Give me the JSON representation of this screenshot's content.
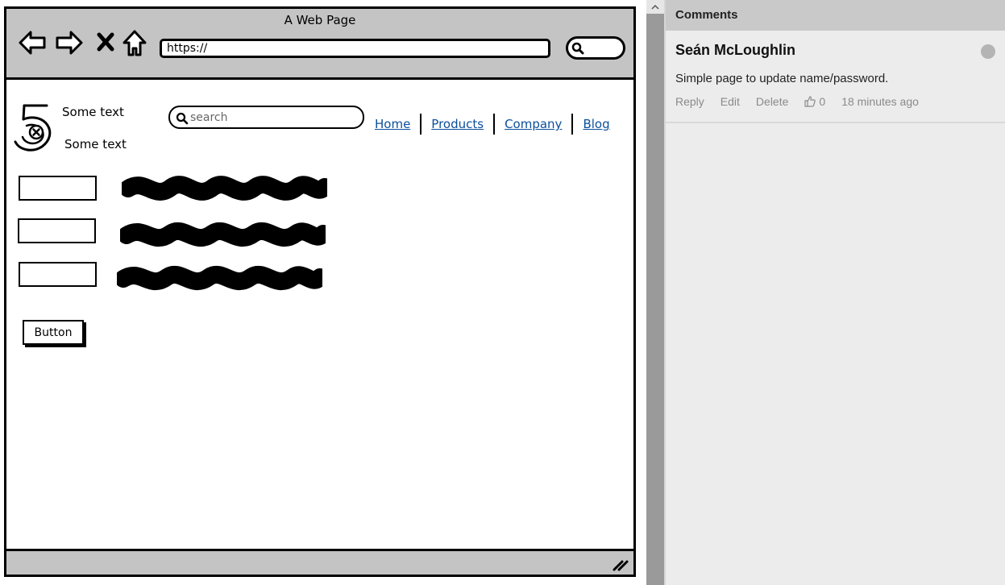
{
  "mockup": {
    "window_title": "A Web Page",
    "url": "https://",
    "logo_label": "5",
    "text_1": "Some text",
    "text_2": "Some text",
    "search_placeholder": "search",
    "nav_links": [
      "Home",
      "Products",
      "Company",
      "Blog"
    ],
    "button_label": "Button",
    "icons": {
      "back": "back-arrow-icon",
      "forward": "forward-arrow-icon",
      "stop": "close-icon",
      "home": "home-icon",
      "search": "search-icon",
      "resize": "resize-grip-icon"
    },
    "colors": {
      "chrome": "#c4c4c4",
      "link": "#0b4f9c"
    }
  },
  "comments": {
    "header": "Comments",
    "items": [
      {
        "author": "Seán McLoughlin",
        "text": "Simple page to update name/password.",
        "actions": [
          "Reply",
          "Edit",
          "Delete"
        ],
        "likes": "0",
        "time": "18 minutes ago"
      }
    ]
  }
}
